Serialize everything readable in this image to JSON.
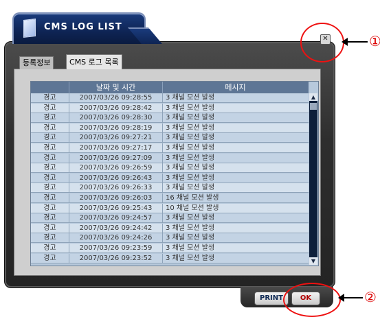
{
  "window": {
    "title": "CMS LOG LIST",
    "close_glyph": "✕"
  },
  "tabs": [
    {
      "label": "등록정보",
      "active": false
    },
    {
      "label": "CMS 로그 목록",
      "active": true
    }
  ],
  "table": {
    "columns": [
      "",
      "날짜 및 시간",
      "메시지"
    ],
    "rows": [
      [
        "경고",
        "2007/03/26 09:28:55",
        "3 채널 모션 발생"
      ],
      [
        "경고",
        "2007/03/26 09:28:42",
        "3 채널 모션 발생"
      ],
      [
        "경고",
        "2007/03/26 09:28:30",
        "3 채널 모션 발생"
      ],
      [
        "경고",
        "2007/03/26 09:28:19",
        "3 채널 모션 발생"
      ],
      [
        "경고",
        "2007/03/26 09:27:21",
        "3 채널 모션 발생"
      ],
      [
        "경고",
        "2007/03/26 09:27:17",
        "3 채널 모션 발생"
      ],
      [
        "경고",
        "2007/03/26 09:27:09",
        "3 채널 모션 발생"
      ],
      [
        "경고",
        "2007/03/26 09:26:59",
        "3 채널 모션 발생"
      ],
      [
        "경고",
        "2007/03/26 09:26:43",
        "3 채널 모션 발생"
      ],
      [
        "경고",
        "2007/03/26 09:26:33",
        "3 채널 모션 발생"
      ],
      [
        "경고",
        "2007/03/26 09:26:03",
        "16 채널 모션 발생"
      ],
      [
        "경고",
        "2007/03/26 09:25:43",
        "10 채널 모션 발생"
      ],
      [
        "경고",
        "2007/03/26 09:24:57",
        "3 채널 모션 발생"
      ],
      [
        "경고",
        "2007/03/26 09:24:42",
        "3 채널 모션 발생"
      ],
      [
        "경고",
        "2007/03/26 09:24:26",
        "3 채널 모션 발생"
      ],
      [
        "경고",
        "2007/03/26 09:23:59",
        "3 채널 모션 발생"
      ],
      [
        "경고",
        "2007/03/26 09:23:52",
        "3 채널 모션 발생"
      ]
    ]
  },
  "buttons": {
    "print": "PRINT",
    "ok": "OK"
  },
  "annotations": {
    "one": "①",
    "two": "②"
  },
  "colors": {
    "accent": "#0e2454",
    "highlight": "#e11111"
  }
}
